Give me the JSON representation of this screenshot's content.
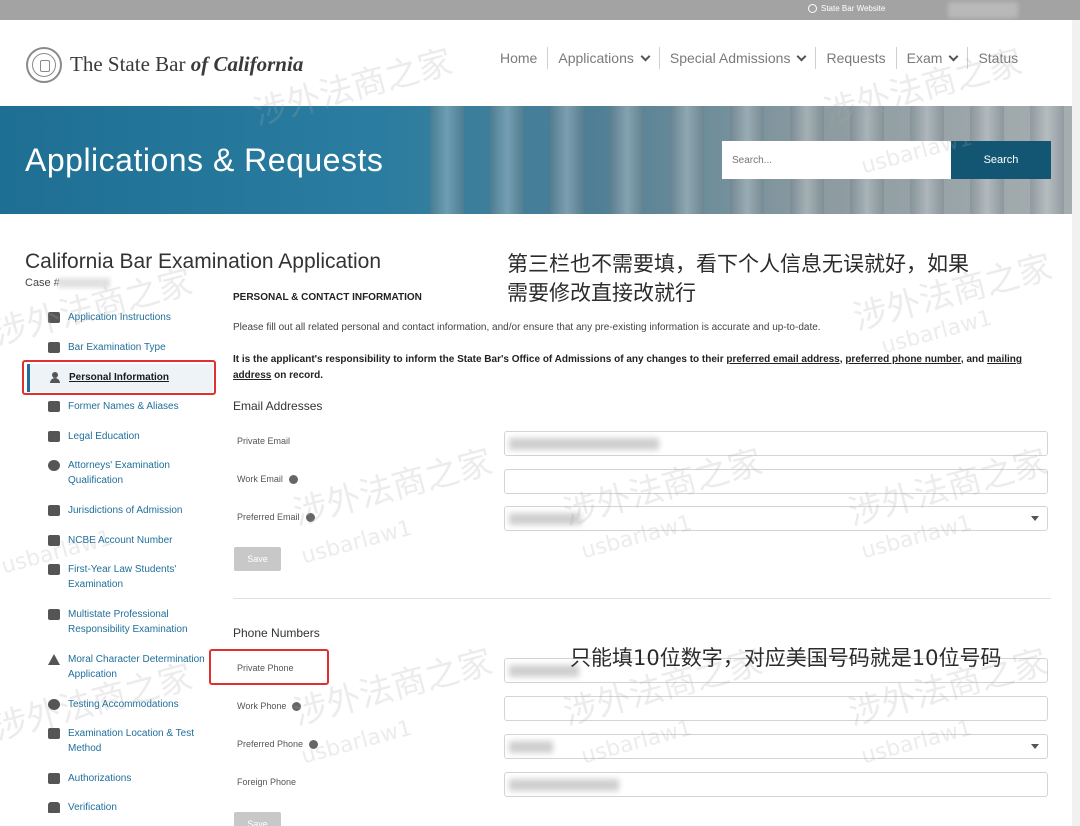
{
  "top_strip": {
    "link_label": "State Bar Website"
  },
  "header": {
    "brand_prefix": "The State Bar ",
    "brand_italic": "of California",
    "nav": [
      {
        "label": "Home",
        "has_dropdown": false
      },
      {
        "label": "Applications",
        "has_dropdown": true
      },
      {
        "label": "Special Admissions",
        "has_dropdown": true
      },
      {
        "label": "Requests",
        "has_dropdown": false
      },
      {
        "label": "Exam",
        "has_dropdown": true
      },
      {
        "label": "Status",
        "has_dropdown": false
      }
    ]
  },
  "banner": {
    "title": "Applications & Requests",
    "search_placeholder": "Search...",
    "search_button": "Search"
  },
  "page": {
    "title": "California Bar Examination Application",
    "case_label": "Case #"
  },
  "sidebar": {
    "items": [
      {
        "label": "Application Instructions",
        "icon": "document-icon"
      },
      {
        "label": "Bar Examination Type",
        "icon": "clipboard-icon"
      },
      {
        "label": "Personal Information",
        "icon": "person-icon",
        "active": true
      },
      {
        "label": "Former Names & Aliases",
        "icon": "id-card-icon"
      },
      {
        "label": "Legal Education",
        "icon": "briefcase-icon"
      },
      {
        "label": "Attorneys' Examination Qualification",
        "icon": "attorney-icon"
      },
      {
        "label": "Jurisdictions of Admission",
        "icon": "gavel-icon"
      },
      {
        "label": "NCBE Account Number",
        "icon": "number-icon"
      },
      {
        "label": "First-Year Law Students' Examination",
        "icon": "edit-doc-icon"
      },
      {
        "label": "Multistate Professional Responsibility Examination",
        "icon": "edit-doc-icon"
      },
      {
        "label": "Moral Character Determination Application",
        "icon": "warning-icon"
      },
      {
        "label": "Testing Accommodations",
        "icon": "globe-icon"
      },
      {
        "label": "Examination Location & Test Method",
        "icon": "location-icon"
      },
      {
        "label": "Authorizations",
        "icon": "list-icon"
      },
      {
        "label": "Verification",
        "icon": "thumbs-up-icon"
      }
    ]
  },
  "form": {
    "section_heading": "PERSONAL & CONTACT INFORMATION",
    "intro": "Please fill out all related personal and contact information, and/or ensure that any pre-existing information is accurate and up-to-date.",
    "notice_prefix": "It is the applicant's responsibility to inform the State Bar's Office of Admissions of any changes to their ",
    "notice_link1": "preferred email address",
    "notice_sep1": ", ",
    "notice_link2": "preferred phone number",
    "notice_sep2": ", and ",
    "notice_link3": "mailing address",
    "notice_suffix": " on record.",
    "email_section": {
      "heading": "Email Addresses",
      "private_label": "Private Email",
      "work_label": "Work Email",
      "preferred_label": "Preferred Email",
      "save_label": "Save"
    },
    "phone_section": {
      "heading": "Phone Numbers",
      "private_label": "Private Phone",
      "work_label": "Work Phone",
      "preferred_label": "Preferred Phone",
      "foreign_label": "Foreign Phone",
      "save_label": "Save"
    }
  },
  "annotations": {
    "note1_line1": "第三栏也不需要填，看下个人信息无误就好，如果",
    "note1_line2": "需要修改直接改就行",
    "note2": "只能填10位数字，对应美国号码就是10位号码"
  },
  "watermark": {
    "cn": "涉外法商之家",
    "en": "usbarlaw1"
  },
  "colors": {
    "banner": "#1e6f93",
    "link": "#1f6f9a",
    "highlight_box": "#e03030",
    "search_button": "#135673"
  }
}
